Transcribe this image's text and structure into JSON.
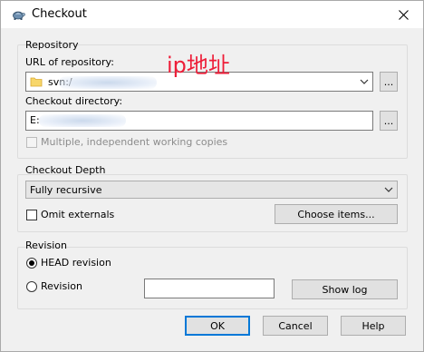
{
  "window": {
    "title": "Checkout"
  },
  "annotation": "ip地址",
  "repository": {
    "group_label": "Repository",
    "url_label": "URL of repository:",
    "url_value": "svn:/",
    "browse_label": "...",
    "dir_label": "Checkout directory:",
    "dir_value": "E:",
    "dir_browse_label": "...",
    "multiple_label": "Multiple, independent working copies"
  },
  "depth": {
    "group_label": "Checkout Depth",
    "selected": "Fully recursive",
    "omit_externals_label": "Omit externals",
    "choose_items_label": "Choose items..."
  },
  "revision": {
    "group_label": "Revision",
    "head_label": "HEAD revision",
    "revision_label": "Revision",
    "revision_value": "",
    "show_log_label": "Show log"
  },
  "buttons": {
    "ok": "OK",
    "cancel": "Cancel",
    "help": "Help"
  }
}
